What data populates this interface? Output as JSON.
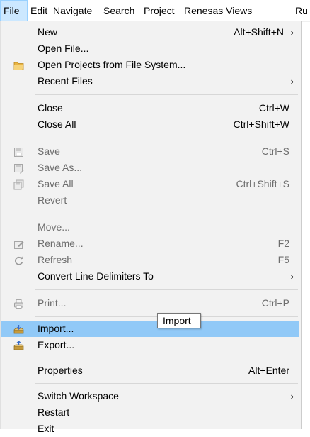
{
  "menubar": {
    "items": [
      "File",
      "Edit",
      "Navigate",
      "Search",
      "Project",
      "Renesas Views",
      "Ru"
    ]
  },
  "menu": {
    "new": {
      "label": "New",
      "shortcut": "Alt+Shift+N"
    },
    "open_file": {
      "label": "Open File..."
    },
    "open_projects": {
      "label": "Open Projects from File System..."
    },
    "recent_files": {
      "label": "Recent Files"
    },
    "close": {
      "label": "Close",
      "shortcut": "Ctrl+W"
    },
    "close_all": {
      "label": "Close All",
      "shortcut": "Ctrl+Shift+W"
    },
    "save": {
      "label": "Save",
      "shortcut": "Ctrl+S"
    },
    "save_as": {
      "label": "Save As..."
    },
    "save_all": {
      "label": "Save All",
      "shortcut": "Ctrl+Shift+S"
    },
    "revert": {
      "label": "Revert"
    },
    "move": {
      "label": "Move..."
    },
    "rename": {
      "label": "Rename...",
      "shortcut": "F2"
    },
    "refresh": {
      "label": "Refresh",
      "shortcut": "F5"
    },
    "convert": {
      "label": "Convert Line Delimiters To"
    },
    "print": {
      "label": "Print...",
      "shortcut": "Ctrl+P"
    },
    "import": {
      "label": "Import..."
    },
    "export": {
      "label": "Export..."
    },
    "properties": {
      "label": "Properties",
      "shortcut": "Alt+Enter"
    },
    "switch_workspace": {
      "label": "Switch Workspace"
    },
    "restart": {
      "label": "Restart"
    },
    "exit": {
      "label": "Exit"
    },
    "submenu_arrow": "›"
  },
  "tooltip": {
    "text": "Import"
  },
  "colors": {
    "highlight": "#91c9f7",
    "menu_bg": "#f2f2f2",
    "disabled": "#6d6d6d",
    "menubar_active": "#cce8ff"
  }
}
